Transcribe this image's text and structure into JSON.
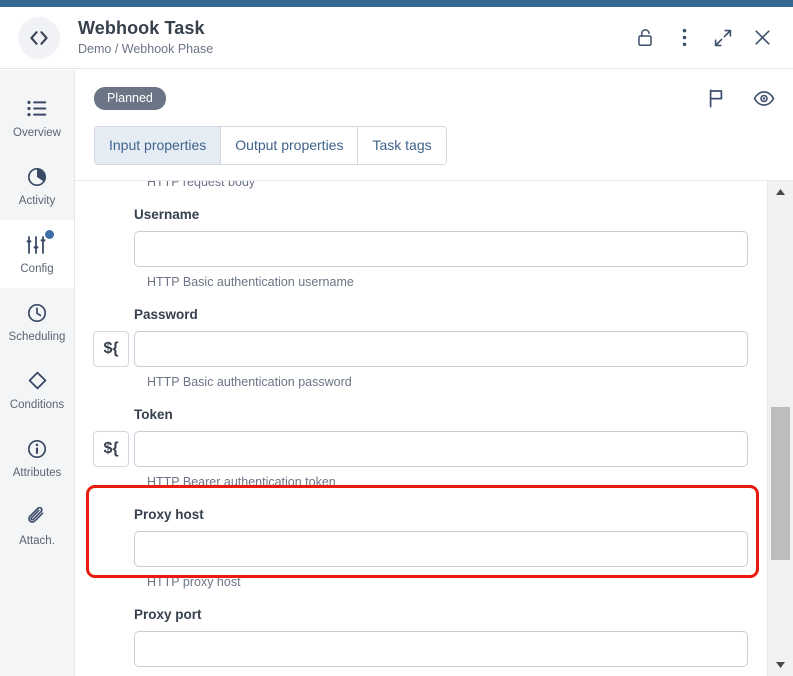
{
  "window": {
    "accent_color": "#35688f",
    "title": "Webhook Task",
    "breadcrumb": "Demo / Webhook Phase",
    "avatar_icon": "code-brackets-icon",
    "actions": [
      {
        "name": "unlock-icon",
        "label": "Unlock"
      },
      {
        "name": "more-options-icon",
        "label": "More options"
      },
      {
        "name": "expand-icon",
        "label": "Expand"
      },
      {
        "name": "close-icon",
        "label": "Close"
      }
    ]
  },
  "sidebar": {
    "items": [
      {
        "label": "Overview",
        "icon": "list-icon",
        "active": false,
        "badge": false
      },
      {
        "label": "Activity",
        "icon": "pie-chart-icon",
        "active": false,
        "badge": false
      },
      {
        "label": "Config",
        "icon": "sliders-icon",
        "active": true,
        "badge": true
      },
      {
        "label": "Scheduling",
        "icon": "clock-icon",
        "active": false,
        "badge": false
      },
      {
        "label": "Conditions",
        "icon": "diamond-icon",
        "active": false,
        "badge": false
      },
      {
        "label": "Attributes",
        "icon": "info-icon",
        "active": false,
        "badge": false
      },
      {
        "label": "Attach.",
        "icon": "paperclip-icon",
        "active": false,
        "badge": false
      }
    ]
  },
  "toolbar": {
    "status": "Planned",
    "status_color": "#6b7585",
    "actions": [
      {
        "name": "flag-icon",
        "label": "Flag"
      },
      {
        "name": "eye-icon",
        "label": "Preview"
      }
    ]
  },
  "tabs": [
    {
      "label": "Input properties",
      "active": true
    },
    {
      "label": "Output properties",
      "active": false
    },
    {
      "label": "Task tags",
      "active": false
    }
  ],
  "form": {
    "top_clipped_help": "HTTP request body",
    "fields": [
      {
        "label": "Username",
        "value": "",
        "help": "HTTP Basic authentication username",
        "has_expression_button": false,
        "expression_button_label": "${",
        "highlighted": false
      },
      {
        "label": "Password",
        "value": "",
        "help": "HTTP Basic authentication password",
        "has_expression_button": true,
        "expression_button_label": "${",
        "highlighted": false
      },
      {
        "label": "Token",
        "value": "",
        "help": "HTTP Bearer authentication token",
        "has_expression_button": true,
        "expression_button_label": "${",
        "highlighted": true
      },
      {
        "label": "Proxy host",
        "value": "",
        "help": "HTTP proxy host",
        "has_expression_button": false,
        "expression_button_label": "${",
        "highlighted": false
      },
      {
        "label": "Proxy port",
        "value": "",
        "help": "",
        "has_expression_button": false,
        "expression_button_label": "${",
        "highlighted": false
      }
    ],
    "highlight_color": "#e81b0c"
  },
  "scrollbar": {
    "up_arrow_icon": "triangle-up-icon",
    "down_arrow_icon": "triangle-down-icon",
    "thumb_position_percent": 46
  }
}
